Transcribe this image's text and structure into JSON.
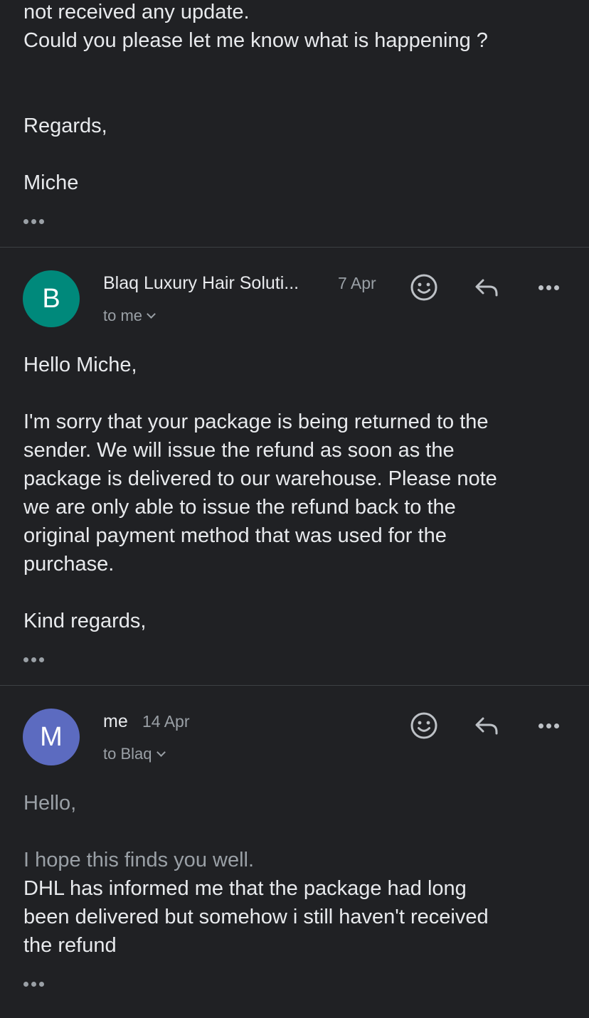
{
  "prev_message": {
    "lines": [
      "not received any update.",
      "Could you please let me know what is happening ?"
    ],
    "regards": "Regards,",
    "signature": "Miche"
  },
  "message1": {
    "avatar_letter": "B",
    "avatar_color": "#00897b",
    "sender": "Blaq Luxury Hair Soluti...",
    "date": "7 Apr",
    "recipient": "to me",
    "greeting": "Hello Miche,",
    "body_lines": [
      "I'm sorry that your package is being returned to the",
      "sender. We will issue the refund as soon as the",
      "package is delivered to our warehouse. Please note",
      "we are only able to issue the refund back to the",
      "original payment method that was used for the",
      "purchase."
    ],
    "closing": "Kind regards,"
  },
  "message2": {
    "avatar_letter": "M",
    "avatar_color": "#5c6bc0",
    "sender": "me",
    "date": "14 Apr",
    "recipient": "to Blaq",
    "greeting": "Hello,",
    "intro": "I hope this finds you well.",
    "body_lines": [
      "DHL has informed me that the package had long",
      "been delivered but somehow i still haven't received",
      "the refund"
    ]
  },
  "icons": {
    "emoji": "smiley-face-icon",
    "reply": "reply-arrow-icon",
    "more": "more-options-icon",
    "expand": "chevron-down-icon",
    "trimmed": "show-trimmed-content-icon"
  }
}
